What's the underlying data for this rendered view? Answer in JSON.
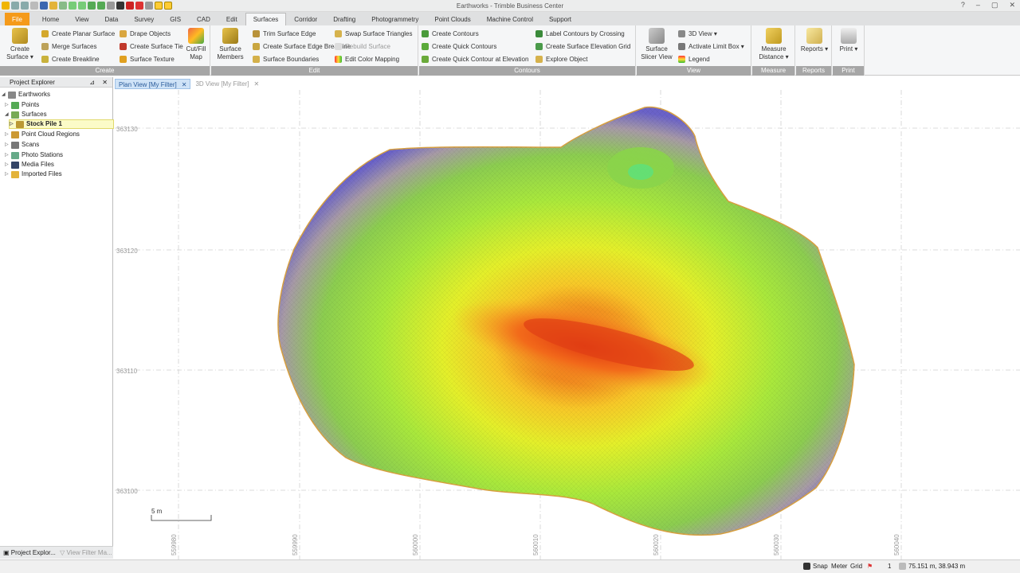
{
  "window": {
    "title": "Earthworks - Trimble Business Center",
    "controls": [
      "?",
      "–",
      "▢",
      "✕"
    ]
  },
  "tabs": [
    "File",
    "Home",
    "View",
    "Data",
    "Survey",
    "GIS",
    "CAD",
    "Edit",
    "Surfaces",
    "Corridor",
    "Drafting",
    "Photogrammetry",
    "Point Clouds",
    "Machine Control",
    "Support"
  ],
  "active_tab": "Surfaces",
  "ribbon": {
    "create": {
      "label": "Create",
      "create_surface": "Create Surface ▾",
      "create_planar_surface": "Create Planar Surface",
      "merge_surfaces": "Merge Surfaces",
      "create_breakline": "Create Breakline",
      "drape_objects": "Drape Objects",
      "create_surface_tie": "Create Surface Tie",
      "surface_texture": "Surface Texture",
      "cut_fill_map": "Cut/Fill Map"
    },
    "edit": {
      "label": "Edit",
      "surface_members": "Surface Members",
      "trim_surface_edge": "Trim Surface Edge",
      "create_surface_edge_breakline": "Create Surface Edge Breakline",
      "surface_boundaries": "Surface Boundaries",
      "swap_surface_triangles": "Swap Surface Triangles",
      "rebuild_surface": "Rebuild Surface",
      "edit_color_mapping": "Edit Color Mapping"
    },
    "contours": {
      "label": "Contours",
      "create_contours": "Create Contours",
      "create_quick_contours": "Create Quick Contours",
      "create_quick_contour_at_elevation": "Create Quick Contour at Elevation",
      "label_contours_by_crossing": "Label Contours by Crossing",
      "create_surface_elevation_grid": "Create Surface Elevation Grid",
      "explore_object": "Explore Object"
    },
    "view": {
      "label": "View",
      "surface_slicer_view": "Surface Slicer View",
      "view_3d": "3D View ▾",
      "activate_limit_box": "Activate Limit Box ▾",
      "legend": "Legend"
    },
    "measure": {
      "label": "Measure",
      "measure_distance": "Measure Distance ▾"
    },
    "reports": {
      "label": "Reports",
      "reports": "Reports ▾"
    },
    "print": {
      "label": "Print",
      "print": "Print ▾"
    }
  },
  "project_explorer": {
    "title": "Project Explorer",
    "items": [
      "Earthworks",
      "Points",
      "Surfaces",
      "Stock Pile 1",
      "Point Cloud Regions",
      "Scans",
      "Photo Stations",
      "Media Files",
      "Imported Files"
    ],
    "selected": "Stock Pile 1"
  },
  "bottom_tabs": [
    "Project Explor...",
    "View Filter Ma..."
  ],
  "doc_tabs": [
    "Plan View [My Filter]",
    "3D View [My Filter]"
  ],
  "plan_view": {
    "northings": [
      "363130",
      "363120",
      "363110",
      "363100"
    ],
    "eastings": [
      "559980",
      "559990",
      "560000",
      "560010",
      "560020",
      "560030",
      "560040"
    ],
    "scale_bar": "5 m"
  },
  "status": {
    "snap": "Snap",
    "units": "Meter",
    "grid": "Grid",
    "page": "1",
    "coords": "75.151 m, 38.943 m"
  },
  "colors": {
    "file_tab": "#f59a1a",
    "ribbon_group_label": "#a6a6a6",
    "selection": "#fbfbc8"
  }
}
